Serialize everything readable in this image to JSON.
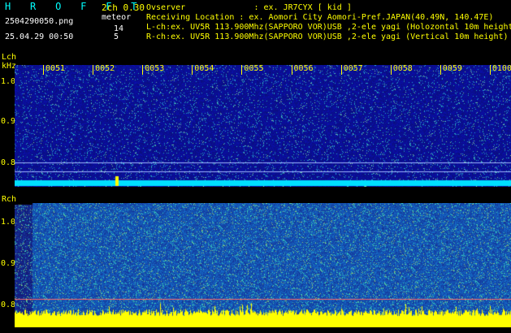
{
  "header": {
    "logo": "H R O F F T",
    "mode": "2ch 0.30",
    "filename": "2504290050.png",
    "meteor_label": "meteor",
    "datetime": "25.04.29 00:50",
    "lch_count": "14",
    "rch_count": "5",
    "observer": "Ovserver              : ex. JR7CYX [ kid ]",
    "location": "Receiving Location : ex. Aomori City Aomori-Pref.JAPAN(40.49N, 140.47E)",
    "lch_info": "L-ch:ex. UV5R 113.900Mhz(SAPPORO VOR)USB ,2-ele yagi (Holozontal 10m height)",
    "rch_info": "R-ch:ex. UV5R 113.900Mhz(SAPPORO VOR)USB ,2-ele yagi (Vertical 10m height)"
  },
  "lch": {
    "label": "Lch",
    "unit": "kHz",
    "yticks": [
      "1.0",
      "0.9",
      "0.8"
    ]
  },
  "rch": {
    "label": "Rch",
    "yticks": [
      "1.0",
      "0.9",
      "0.8"
    ]
  },
  "time_ticks": [
    "0051",
    "0052",
    "0053",
    "0054",
    "0055",
    "0056",
    "0057",
    "0058",
    "0059",
    "0100"
  ],
  "colors": {
    "label_yellow": "#ffff00",
    "logo_cyan": "#00ffff",
    "noise_blue": "#1a2aa8",
    "baseline_cyan": "#00e0ff",
    "signal_yellow": "#ffff00"
  }
}
